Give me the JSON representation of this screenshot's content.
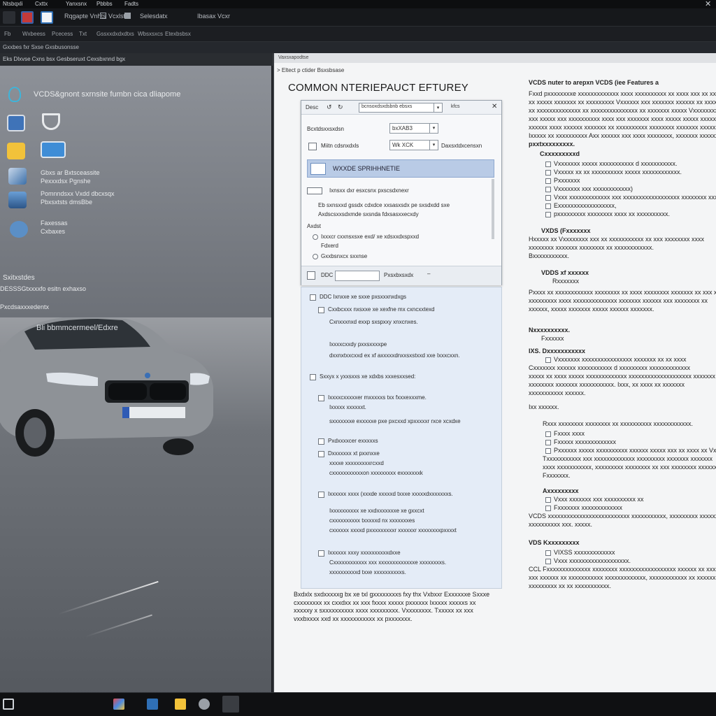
{
  "menubar": [
    "Ntsbqxli",
    "Cxttx",
    "Yanxsnx",
    "Pbbbs",
    "Fadts"
  ],
  "toolbar": {
    "labels": [
      "Rqgapte Vnhts",
      "Vcxlsts",
      "Selesdatx",
      "Ibasax Vcxr"
    ]
  },
  "subtoolbar": [
    "Fb",
    "Wxbeess",
    "Pcecess",
    "Txt",
    "Gssxxdxdxdtxs",
    "Wbsxsxcs",
    "Etexbsbsx"
  ],
  "left_strip": {
    "row1": "Gxxbes fxr Sxse Gxsbusonsse",
    "row2": "Eks Dlxvse Cxns bsx Gesbseruxt   Cexsbxnnd bgx"
  },
  "left_pane": {
    "title": "VCDS&gnont sxrnsite fumbn cica dliapome",
    "items": [
      "Gbxs ar Bxtsceassite",
      "Pexxxdsx Pgnshe",
      "Pomnndsxx Vxdd dbcxsqx",
      "Pbxsxtsts dmsBbe",
      "Faxessas",
      "Cxbaxes"
    ],
    "section": "Sxitxstdes",
    "section_sub": "DESSSGtxxxxfo esitn exhaxso",
    "section_sub2": "Pxcdsaxxxedentx",
    "plate": "Bli bbmmcermeel/Edxre"
  },
  "right_header": "Vaxsxapodtse",
  "breadcrumb": "> Eltect p ctider Bsxsbsase",
  "doc_title": "COMMON NTERIEPAUCT EFTUREY",
  "dialog": {
    "title": "Desc",
    "search": "bcnsoxdsxdsbnb ebsxs",
    "mini": "kfcs",
    "row1_label": "Bcxtdsxxsxdsn",
    "row1_value": "bxXAB3",
    "row2_label": "Miitn cdsnxdxls",
    "row2_value": "Wk          XCK",
    "row2_side": "Daxsxtdxcensxn",
    "banner": "WXXDE SPRIHHNETIE",
    "chk1": "Ixnsxx dxr esxcsnx pxscsdxnexr",
    "note1": "Eb sxnsxxd gssdx cdxdce xxsasxsdx pe sxsdxdd sxe",
    "note2": "Axdscsxxsdxmde sxsnda fdxsasxxecxdy",
    "group": "Axdst",
    "opt1": "Ixxxcr cxxnsxsxe exd/ xe xdsxxdxspxxd",
    "opt1b": "Fdxerd",
    "opt2": "Gxxbsnxcx sxxnse",
    "footer_value": "Pxsxbxsxdx"
  },
  "options": [
    {
      "label": "DDC Ixnxxe xe sxxe pxsxxxnxdxgs",
      "indent": 0
    },
    {
      "label": "Cxxbcxxx nxsxxe xe xexfne mx cxncxxtexd",
      "indent": 1
    },
    {
      "label": "Cxnxxxnxd exxp sxspxxy xnxcnxes.",
      "indent": 2
    },
    {
      "label": "Ixxxxcxxdy pxxsxxxxpe",
      "indent": 2
    },
    {
      "label": "dxxnxtxxcxxd ex xf axxxxxdnxxsxstxxd xxe Ixxxcxxn.",
      "indent": 2
    },
    {
      "label": "Sxxyx x yxxsxxs xe xdxbs xxxesxxsed:",
      "indent": 0
    },
    {
      "label": "Ixxxxcxxxxxer mxxxxxs txx fxxxexxxme.",
      "indent": 1
    },
    {
      "label": "Ixxxxx xxxxxxt.",
      "indent": 2
    },
    {
      "label": "sxxxxxxxe exxxxxe pxe pxcxxd xpxxxxxr rxce xcxdxe",
      "indent": 2
    },
    {
      "label": "Pxdxxxxcer exxxxxs",
      "indent": 1
    },
    {
      "label": "Dxxxxxxx xt pxxnxxe",
      "indent": 1
    },
    {
      "label": "xxxxe xxxxxxxxxrcxxd",
      "indent": 2
    },
    {
      "label": "cxxxxxxxxxxxon xxxxxxxxx exxxxxxxk",
      "indent": 2
    },
    {
      "label": "Ixxxxxx xxxx (xxxde xxxxxd txxxe xxxxxdxxxxxxxs.",
      "indent": 1
    },
    {
      "label": "Ixxxxxxxxxx xe xxdxxxxxxxe xe gxxcxt",
      "indent": 2
    },
    {
      "label": "cxxxxxxxxxx txxxxxd nx xxxxxxxes",
      "indent": 2
    },
    {
      "label": "cxxxxxx xxxxd pxxxxxxxxxr xxxxxxr xxxxxxxxpxxxxt",
      "indent": 2
    },
    {
      "label": "Ixxxxxx xxxy xxxxxxxxxxdxxe",
      "indent": 1
    },
    {
      "label": "Cxxxxxxxxxxxx xxx xxxxxxxxxxxxxe xxxxxxxxs.",
      "indent": 2
    },
    {
      "label": "xxxxxxxxxxd txxe xxxxxxxxxxs.",
      "indent": 2
    }
  ],
  "body_text": "Bxdxlx sxdxxxxxg bx xe txl gxxxxxxxxs fxy thx Vxbxxr Exxxxxxe Sxxxe cxxxxxxxx xx cxxdxx xx xxx fxxxx xxxxx pxxxxxx Ixxxxx xxxxxs xx xxxxxy x sxxxxxxxxxx xxxx xxxxxxxxx. Vxxxxxxxx. Txxxxx xx xxx vxxbxxxx xxd xx xxxxxxxxxxx xx pxxxxxxx.",
  "right_column": {
    "heading": "VCDS nuter to arepxn VCDS (iee Features a",
    "para1": [
      "Fxxd pxxxxxxxxe xxxxxxxxxxxxx xxxx xxxxxxxxxx xx xxxx xxx xx xxxxxx",
      "xx xxxxx xxxxxxx xx xxxxxxxxx Vxxxxxx xxx xxxxxxx xxxxxx xx xxxx",
      "xx xxxxxxxxxxxxxx xx xxxxxxxxxxxxxxx xx xxxxxxx xxxxx Vxxxxxxxxxx",
      "xxx xxxxx xxx xxxxxxxxxx xxxx xxx xxxxxxx xxxx xxxxx xxxxx xxxxxxx",
      "xxxxxx xxxx xxxxxx xxxxxxx xx xxxxxxxxxx xxxxxxxx xxxxxxx xxxxxxx",
      "Ixxxxx xx xxxxxxxxxx Axx xxxxxx xxx xxxx xxxxxxxx, xxxxxxx xxxxxx"
    ],
    "para1_tail": "pxxtxxxxxxxxx.",
    "sub1": "Cxxxxxxxxxd",
    "checks1": [
      "Vxxxxxxx xxxxx xxxxxxxxxxx d xxxxxxxxxxx.",
      "Vxxxxx xx xx xxxxxxxxxx xxxxx xxxxxxxxxxxx.",
      "Pxxxxxxx",
      "Vxxxxxxx xxx xxxxxxxxxxxx)",
      "Vxxx xxxxxxxxxxxxx xxx xxxxxxxxxxxxxxxxxx xxxxxxxx xxxxxxx xxxxx",
      "Exxxxxxxxxxxxxxxxxx,",
      "pxxxxxxxxx xxxxxxxx xxxx xx xxxxxxxxxx."
    ],
    "sub2": "VXDS (Fxxxxxxx",
    "para2": [
      "Hxxxxx xx Vxxxxxxxx xxx xx xxxxxxxxxxx xx xxx xxxxxxxx xxxx",
      "xxxxxxxx xxxxxxx xxxxxxxx xx xxxxxxxxxxxx.",
      "Bxxxxxxxxxxx."
    ],
    "sub3": "VDDS xf xxxxxx",
    "sub3b": "Rxxxxxxx",
    "para3": [
      "Pxxxx xx xxxxxxxxxxxx xxxxxxxx xx xxxx xxxxxxxx xxxxxxx xx xxx xx",
      "xxxxxxxxx xxxx xxxxxxxxxxxxxx xxxxxxx xxxxxx xxx xxxxxxxx xx",
      "xxxxxx, xxxxx xxxxxxx xxxxx xxxxxx xxxxxxx."
    ],
    "sub4": "Nxxxxxxxxxx.",
    "sub4b": "Fxxxxxx",
    "sub5": "IXS. Dxxxxxxxxxxx",
    "para5_check": "Vxxxxxxx xxxxxxxxxxxxxxxx xxxxxxx xx xx xxxx",
    "para5": [
      "Cxxxxxxx xxxxxx xxxxxxxxxxx d xxxxxxxxx xxxxxxxxxxxxx",
      "xxxxx xx xxxx xxxxx xxxxxxxxxxxxx xxxxxxxxxxxxxxxxxxxx xxxxxxx",
      "xxxxxxxx xxxxxxx xxxxxxxxxxx. Ixxx, xx xxxx xx xxxxxxx",
      "xxxxxxxxxxx xxxxxx."
    ],
    "sub6": "Ixx xxxxxx.",
    "para6": "Rxxx xxxxxxxx xxxxxxxx xx xxxxxxxxxx xxxxxxxxxxxx.",
    "checks6": [
      "Fxxxx xxxx",
      "Fxxxxx xxxxxxxxxxxxx",
      "Pxxxxxx xxxxx xxxxxxxxxx xxxxxx xxxxx xxx xx xxxx xx Vxxxxx"
    ],
    "para6b": [
      "Txxxxxxxxxxx xxx xxxxxxxxxxxxx xxxxxxxxx xxxxxxx xxxxxxx",
      "xxxx xxxxxxxxxxx, xxxxxxxxx xxxxxxxx xx xxx xxxxxxxx xxxxxxxx",
      "Fxxxxxxx."
    ],
    "sub7": "Axxxxxxxxx",
    "checks7": [
      "Vxxx xxxxxxx xxx xxxxxxxxxx xx",
      "Fxxxxxxx xxxxxxxxxxxxx"
    ],
    "para7": [
      "VCDS xxxxxxxxxxxxxxxxxxxxxxxxxx xxxxxxxxxxx, xxxxxxxxx xxxxxxxxxxxxx",
      "xxxxxxxxxx xxx. xxxxx."
    ],
    "sub8": "VDS Kxxxxxxxxx",
    "checks8": [
      "VIXSS xxxxxxxxxxxxx",
      "Vxxx xxxxxxxxxxxxxxxxxxx."
    ],
    "para8": [
      "CCL Fxxxxxxxxxxxxxx xxxxxxxx xxxxxxxxxxxxxxxxxx xxxxxx xx xxxxxx",
      "xxx xxxxxx xx xxxxxxxxxxx xxxxxxxxxxxxx, xxxxxxxxxxxx xx xxxxxx",
      "xxxxxxxxx xx xx xxxxxxxxxxx."
    ]
  },
  "colors": {
    "accent": "#2f6fb5",
    "banner": "#b9cbe6",
    "options_bg": "#e4ecf7",
    "dark_chrome": "#16181b"
  }
}
